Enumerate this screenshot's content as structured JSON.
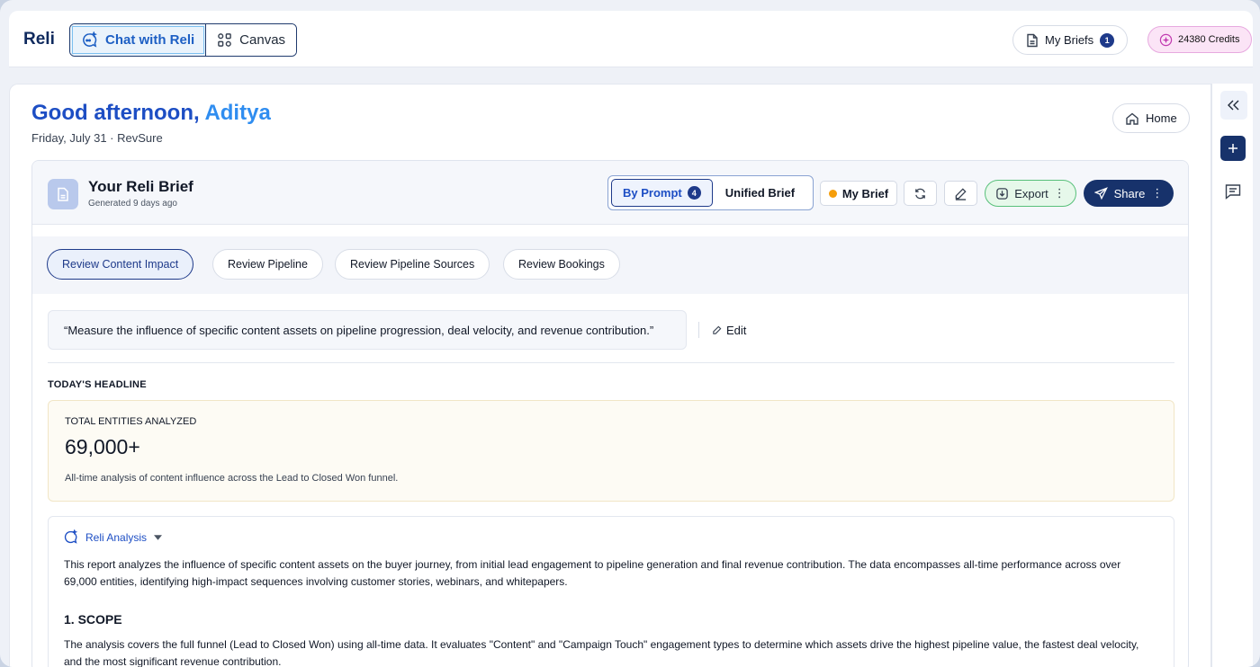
{
  "app": {
    "brand": "Reli"
  },
  "top_nav": {
    "chat_label": "Chat with Reli",
    "canvas_label": "Canvas",
    "my_briefs_label": "My Briefs",
    "my_briefs_count": "1",
    "credits_label": "24380 Credits"
  },
  "header": {
    "greeting": "Good afternoon,",
    "user_name": "Aditya",
    "date_line": "Friday, July 31 · RevSure",
    "home_label": "Home"
  },
  "brief": {
    "title": "Your Reli Brief",
    "generated": "Generated 9 days ago",
    "mode_by_prompt": "By Prompt",
    "mode_by_prompt_count": "4",
    "mode_unified": "Unified Brief",
    "my_brief_label": "My Brief",
    "export_label": "Export",
    "share_label": "Share",
    "menu_glyph": "⋮"
  },
  "tabs": [
    {
      "label": "Review Content Impact",
      "active": true
    },
    {
      "label": "Review Pipeline",
      "active": false
    },
    {
      "label": "Review Pipeline Sources",
      "active": false
    },
    {
      "label": "Review Bookings",
      "active": false
    }
  ],
  "prompt": {
    "text": "“Measure the influence of specific content assets on pipeline progression, deal velocity, and revenue contribution.”",
    "edit_label": "Edit"
  },
  "headline": {
    "section_title": "TODAY'S HEADLINE",
    "metric_label": "TOTAL ENTITIES ANALYZED",
    "metric_value": "69,000+",
    "metric_desc": "All-time analysis of content influence across the Lead to Closed Won funnel."
  },
  "analysis": {
    "title": "Reli Analysis",
    "intro": "This report analyzes the influence of specific content assets on the buyer journey, from initial lead engagement to pipeline generation and final revenue contribution. The data encompasses all-time performance across over 69,000 entities, identifying high-impact sequences involving customer stories, webinars, and whitepapers.",
    "scope_heading": "1. SCOPE",
    "scope_text": "The analysis covers the full funnel (Lead to Closed Won) using all-time data. It evaluates \"Content\" and \"Campaign Touch\" engagement types to determine which assets drive the highest pipeline value, the fastest deal velocity, and the most significant revenue contribution."
  },
  "colors": {
    "accent": "#1d4ec4",
    "navy": "#17326b",
    "export_bg": "#e6f8ea",
    "credits_bg": "#fbe4f6",
    "status_dot": "#f59e0b"
  }
}
